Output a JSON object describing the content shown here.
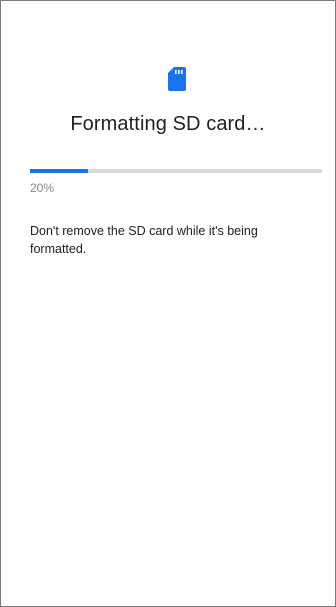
{
  "icon": {
    "name": "sd-card-icon",
    "color": "#1a73e8"
  },
  "title": "Formatting SD card…",
  "progress": {
    "value": 0.2,
    "label": "20%",
    "fill_color": "#1a73e8",
    "track_color": "#d9d9d9"
  },
  "message": "Don't remove the SD card while it's being formatted."
}
